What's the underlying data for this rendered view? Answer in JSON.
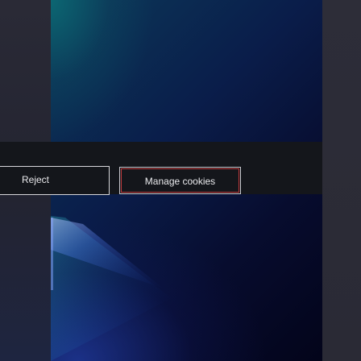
{
  "cookie_banner": {
    "reject_label": "Reject",
    "manage_label": "Manage cookies"
  },
  "colors": {
    "banner_background": "#14161b",
    "focus_outline": "#c0393b",
    "hero_teal": "#0c6e76",
    "hero_navy": "#070c2e"
  }
}
